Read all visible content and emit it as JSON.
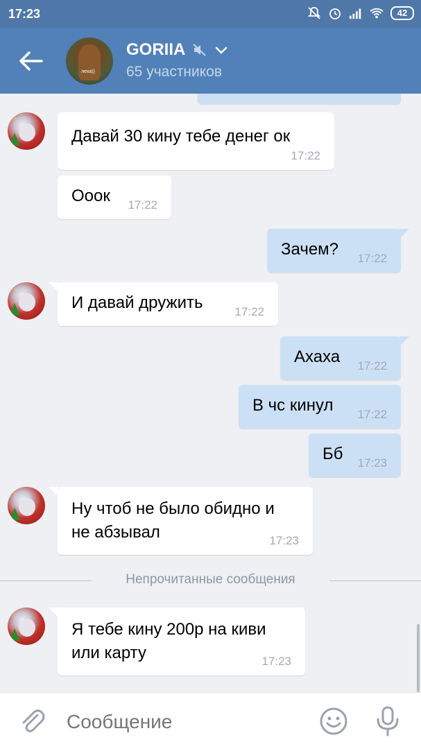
{
  "status_bar": {
    "time": "17:23",
    "battery": "42",
    "icons": [
      "mute-notification-icon",
      "alarm-icon",
      "signal-icon",
      "wifi-icon",
      "battery-icon"
    ]
  },
  "header": {
    "title": "GORIIA",
    "subtitle": "65 участников",
    "muted_icon": "muted-speaker-icon",
    "avatar_caption": "леха))",
    "colors": {
      "bar": "#5181b8",
      "status_bar": "#4f78a9"
    }
  },
  "messages": [
    {
      "dir": "in",
      "text": "Давай 30 кину тебе денег ок",
      "time": "17:22"
    },
    {
      "dir": "in",
      "text": "Ооок",
      "time": "17:22"
    },
    {
      "dir": "out",
      "text": "Зачем?",
      "time": "17:22"
    },
    {
      "dir": "in",
      "text": "И давай дружить",
      "time": "17:22"
    },
    {
      "dir": "out",
      "text": "Ахаха",
      "time": "17:22"
    },
    {
      "dir": "out",
      "text": "В чс кинул",
      "time": "17:22"
    },
    {
      "dir": "out",
      "text": "Бб",
      "time": "17:23"
    },
    {
      "dir": "in",
      "text_line1": "Ну чтоб не было обидно и",
      "text_line2": "не абзывал",
      "time": "17:23"
    },
    {
      "dir": "in",
      "text_line1": "Я тебе кину 200р на киви",
      "text_line2": "или карту",
      "time": "17:23"
    }
  ],
  "unread_divider": "Непрочитанные сообщения",
  "composer": {
    "placeholder": "Сообщение"
  },
  "colors": {
    "outgoing_bubble": "#cce0f5",
    "incoming_bubble": "#ffffff",
    "chat_background": "#eef0f3"
  }
}
